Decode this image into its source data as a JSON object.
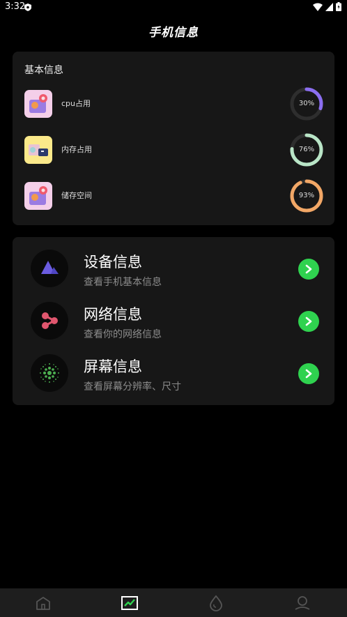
{
  "status": {
    "time": "3:32"
  },
  "title": "手机信息",
  "basic": {
    "title": "基本信息",
    "items": [
      {
        "label": "cpu占用",
        "percent": "30%",
        "value": 0.3,
        "color": "#8b6ef0"
      },
      {
        "label": "内存占用",
        "percent": "76%",
        "value": 0.76,
        "color": "#b9e5c7"
      },
      {
        "label": "储存空间",
        "percent": "93%",
        "value": 0.93,
        "color": "#f2a766"
      }
    ]
  },
  "info": [
    {
      "title": "设备信息",
      "subtitle": "查看手机基本信息",
      "icon": "triangle-logo-icon"
    },
    {
      "title": "网络信息",
      "subtitle": "查看你的网络信息",
      "icon": "network-nodes-icon"
    },
    {
      "title": "屏幕信息",
      "subtitle": "查看屏幕分辨率、尺寸",
      "icon": "screen-dots-icon"
    }
  ],
  "nav": [
    {
      "name": "home",
      "icon": "home-icon",
      "active": false
    },
    {
      "name": "stats",
      "icon": "chart-icon",
      "active": true
    },
    {
      "name": "discover",
      "icon": "drop-icon",
      "active": false
    },
    {
      "name": "profile",
      "icon": "user-icon",
      "active": false
    }
  ],
  "colors": {
    "accent": "#2fd24f",
    "card": "#171717",
    "background": "#000000"
  }
}
